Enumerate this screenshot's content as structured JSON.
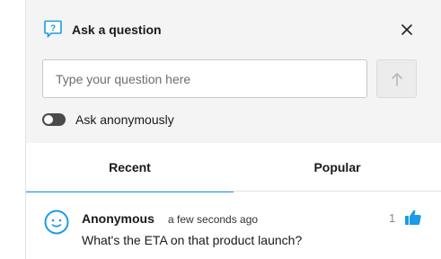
{
  "header": {
    "title": "Ask a question",
    "icon": "chat-question-icon",
    "close_icon": "close-icon"
  },
  "composer": {
    "placeholder": "Type your question here",
    "value": "",
    "send_icon": "arrow-up-icon",
    "anonymous_label": "Ask anonymously",
    "anonymous_enabled": false
  },
  "tabs": [
    {
      "label": "Recent",
      "active": true
    },
    {
      "label": "Popular",
      "active": false
    }
  ],
  "questions": [
    {
      "author": "Anonymous",
      "time": "a few seconds ago",
      "text": "What's the ETA on that product launch?",
      "likes": "1",
      "avatar_icon": "smiley-avatar-icon",
      "like_icon": "thumbs-up-icon"
    }
  ],
  "colors": {
    "accent": "#1a9be6",
    "header_bg": "#f4f4f4",
    "text": "#1a1a1a"
  }
}
